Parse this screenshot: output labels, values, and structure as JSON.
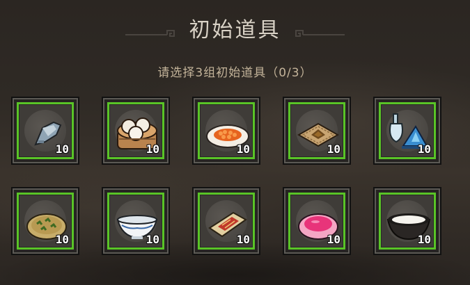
{
  "header": {
    "title": "初始道具",
    "subtitle": "请选择3组初始道具（0/3）"
  },
  "colors": {
    "selected_border": "#59c427",
    "title_text": "#d9d2c6",
    "subtitle_text": "#c4b49a"
  },
  "items": [
    {
      "icon": "stone-icon",
      "qty": "10"
    },
    {
      "icon": "steamed-buns-icon",
      "qty": "10"
    },
    {
      "icon": "salmon-roe-plate-icon",
      "qty": "10"
    },
    {
      "icon": "spice-cloth-icon",
      "qty": "10"
    },
    {
      "icon": "bottle-and-crystal-icon",
      "qty": "10"
    },
    {
      "icon": "herb-pancake-icon",
      "qty": "10"
    },
    {
      "icon": "porcelain-bowl-icon",
      "qty": "10"
    },
    {
      "icon": "red-box-icon",
      "qty": "10"
    },
    {
      "icon": "pink-bowl-icon",
      "qty": "10"
    },
    {
      "icon": "rice-bowl-icon",
      "qty": "10"
    }
  ]
}
